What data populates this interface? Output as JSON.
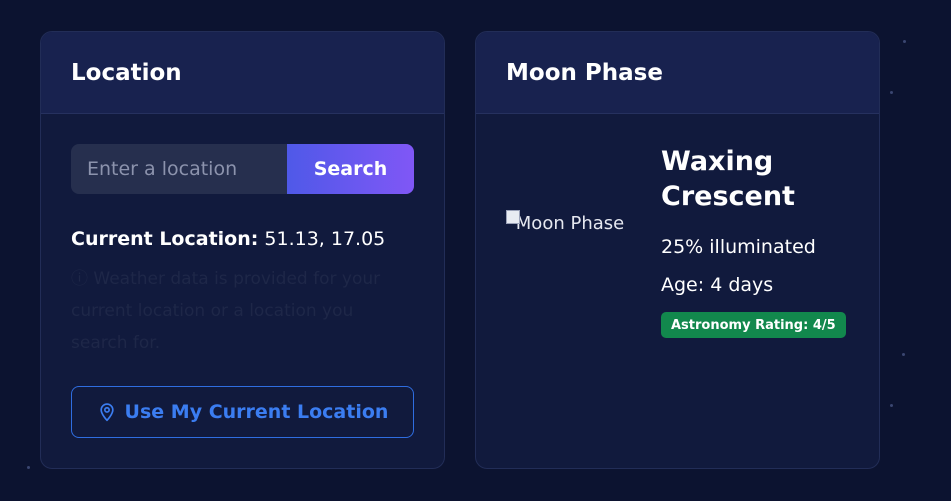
{
  "location_card": {
    "title": "Location",
    "search_placeholder": "Enter a location",
    "search_label": "Search",
    "current_location_label": "Current Location:",
    "current_location_value": "51.13, 17.05",
    "note": "ⓘ Weather data is provided for your current location or a location you search for.",
    "use_location_label": "Use My Current Location",
    "use_location_icon": "map-pin-icon"
  },
  "moon_card": {
    "title": "Moon Phase",
    "image_alt": "Moon Phase",
    "phase_name": "Waxing Crescent",
    "illumination": "25% illuminated",
    "age": "Age: 4 days",
    "rating": "Astronomy Rating: 4/5"
  },
  "colors": {
    "background": "#0c1330",
    "card": "#111a3d",
    "accent_gradient_start": "#4f59e8",
    "accent_gradient_end": "#8057f6",
    "link_blue": "#3b7df1",
    "badge_green": "#12884d"
  }
}
